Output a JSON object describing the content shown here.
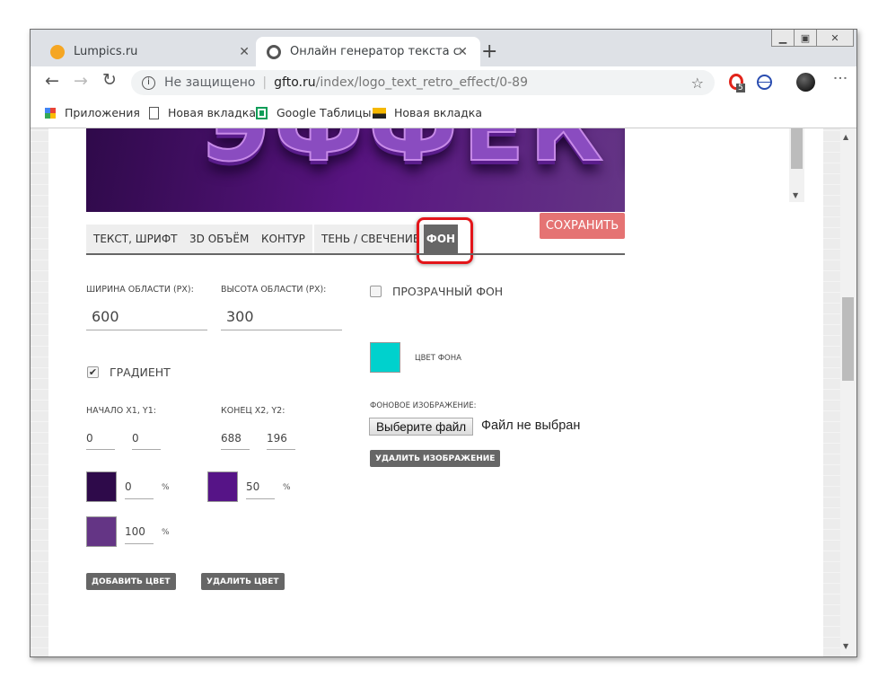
{
  "browser": {
    "tabs": [
      {
        "title": "Lumpics.ru",
        "icon": "orange-favicon"
      },
      {
        "title": "Онлайн генератор текста создат",
        "icon": "gfto-favicon"
      }
    ],
    "new_tab": "+",
    "security": "Не защищено",
    "url_host": "gfto.ru",
    "url_path": "/index/logo_text_retro_effect/0-89",
    "extension_badge": "5",
    "bookmarks": [
      {
        "label": "Приложения",
        "icon": "apps-grid-icon"
      },
      {
        "label": "Новая вкладка",
        "icon": "page-icon"
      },
      {
        "label": "Google Таблицы",
        "icon": "sheets-icon"
      },
      {
        "label": "Новая вкладка",
        "icon": "image-icon"
      }
    ]
  },
  "preview": {
    "text": "ЭФФЕКТ"
  },
  "editor": {
    "save": "СОХРАНИТЬ",
    "tabs": [
      "ТЕКСТ, ШРИФТ",
      "3D ОБЪЁМ",
      "КОНТУР",
      "ТЕНЬ / СВЕЧЕНИЕ",
      "ФОН"
    ],
    "active_tab": "ФОН",
    "width_label": "ШИРИНА ОБЛАСТИ (PX):",
    "width_value": "600",
    "height_label": "ВЫСОТА ОБЛАСТИ (PX):",
    "height_value": "300",
    "gradient_label": "ГРАДИЕНТ",
    "gradient_checked": true,
    "start_label": "НАЧАЛО X1, Y1:",
    "x1": "0",
    "y1": "0",
    "end_label": "КОНЕЦ X2, Y2:",
    "x2": "688",
    "y2": "196",
    "stops": [
      {
        "color": "#2e0a4a",
        "pos": "0"
      },
      {
        "color": "#561487",
        "pos": "50"
      },
      {
        "color": "#643585",
        "pos": "100"
      }
    ],
    "pct": "%",
    "add_color": "ДОБАВИТЬ ЦВЕТ",
    "remove_color": "УДАЛИТЬ ЦВЕТ",
    "transparent_label": "ПРОЗРАЧНЫЙ ФОН",
    "transparent_checked": false,
    "bg_color_label": "ЦВЕТ ФОНА",
    "bg_color": "#00d1cd",
    "bg_image_label": "ФОНОВОЕ ИЗОБРАЖЕНИЕ:",
    "choose_file": "Выберите файл",
    "no_file": "Файл не выбран",
    "remove_image": "УДАЛИТЬ ИЗОБРАЖЕНИЕ"
  }
}
